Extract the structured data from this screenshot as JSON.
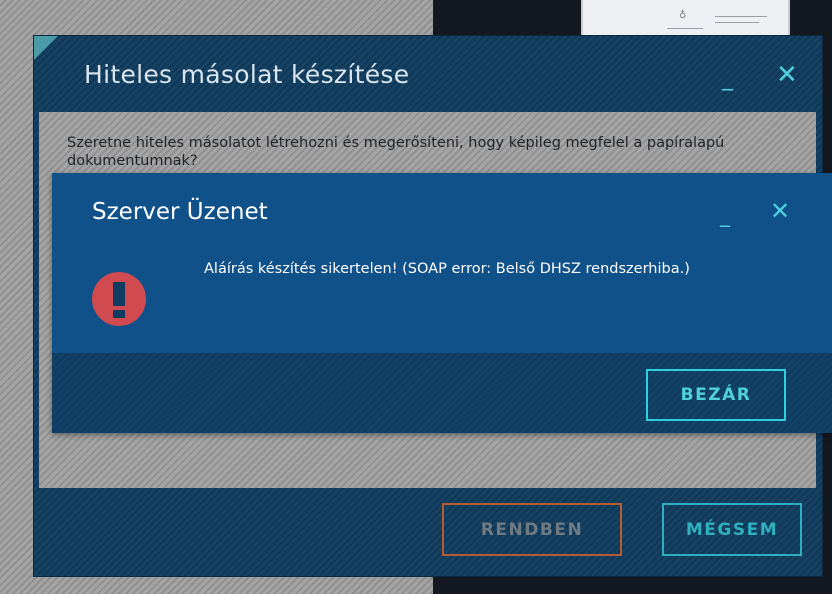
{
  "outer_dialog": {
    "title": "Hiteles másolat készítése",
    "minimize": "_",
    "close": "✕",
    "message": "Szeretne hiteles másolatot létrehozni és megerősíteni, hogy képileg megfelel a papíralapú dokumentumnak?",
    "ok_label": "RENDBEN",
    "cancel_label": "MÉGSEM"
  },
  "inner_dialog": {
    "title": "Szerver Üzenet",
    "minimize": "_",
    "close": "✕",
    "error_icon": "exclamation-icon",
    "message": "Aláírás készítés sikertelen! (SOAP error: Belső DHSZ rendszerhiba.)",
    "close_label": "BEZÁR"
  },
  "colors": {
    "accent": "#2fb0be",
    "error": "#d14a4f",
    "ok_border": "#b85a32",
    "dialog_bg": "#0f3a5b"
  }
}
